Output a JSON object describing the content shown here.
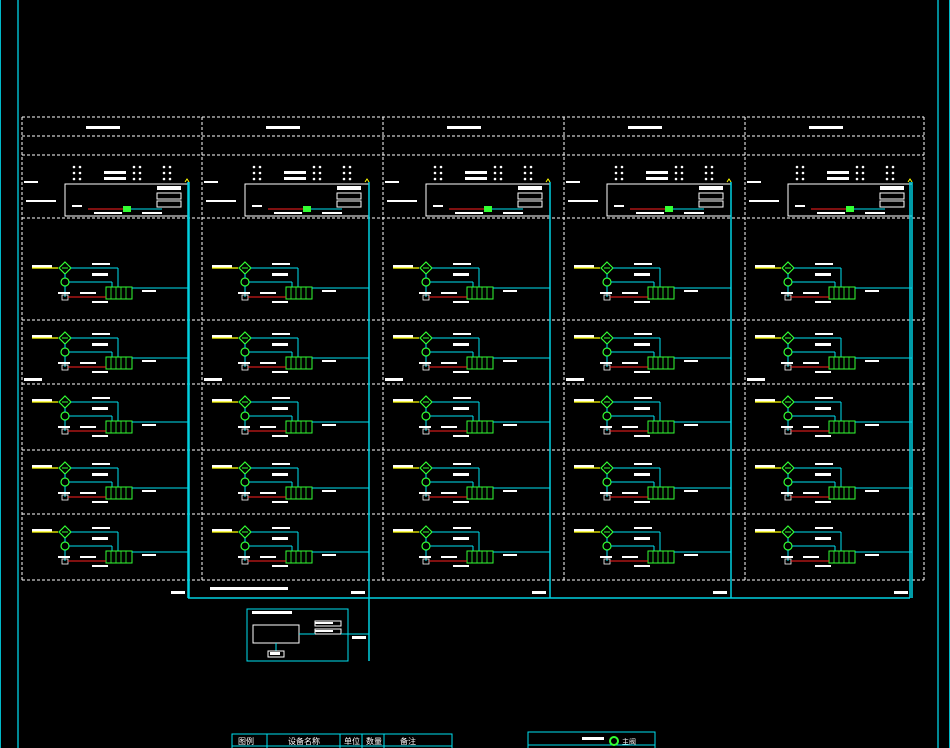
{
  "colors": {
    "background": "#000000",
    "frame": "#00b8c8",
    "grid": "#ffffff",
    "bus": "#00d0e0",
    "cyan": "#00e0f0",
    "green": "#33ff33",
    "yellow": "#ffff00",
    "red": "#ff2020",
    "label": "#ffffff"
  },
  "icons": [
    "valve-icon",
    "pump-icon",
    "terminal-block-icon",
    "junction-dot-icon"
  ],
  "legend": {
    "headers": [
      "图例",
      "设备名称",
      "单位",
      "数量",
      "备注"
    ],
    "symbol_label": "主阀"
  }
}
